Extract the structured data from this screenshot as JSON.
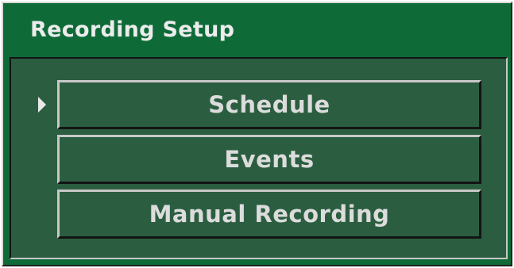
{
  "window": {
    "title": "Recording Setup"
  },
  "menu": {
    "selected_index": 0,
    "items": [
      {
        "label": "Schedule"
      },
      {
        "label": "Events"
      },
      {
        "label": "Manual Recording"
      }
    ]
  },
  "icons": {
    "selection_indicator": "right-triangle-arrow"
  },
  "colors": {
    "title_bar": "#0e6b38",
    "panel": "#2b5e40",
    "text": "#dcdcdc"
  }
}
